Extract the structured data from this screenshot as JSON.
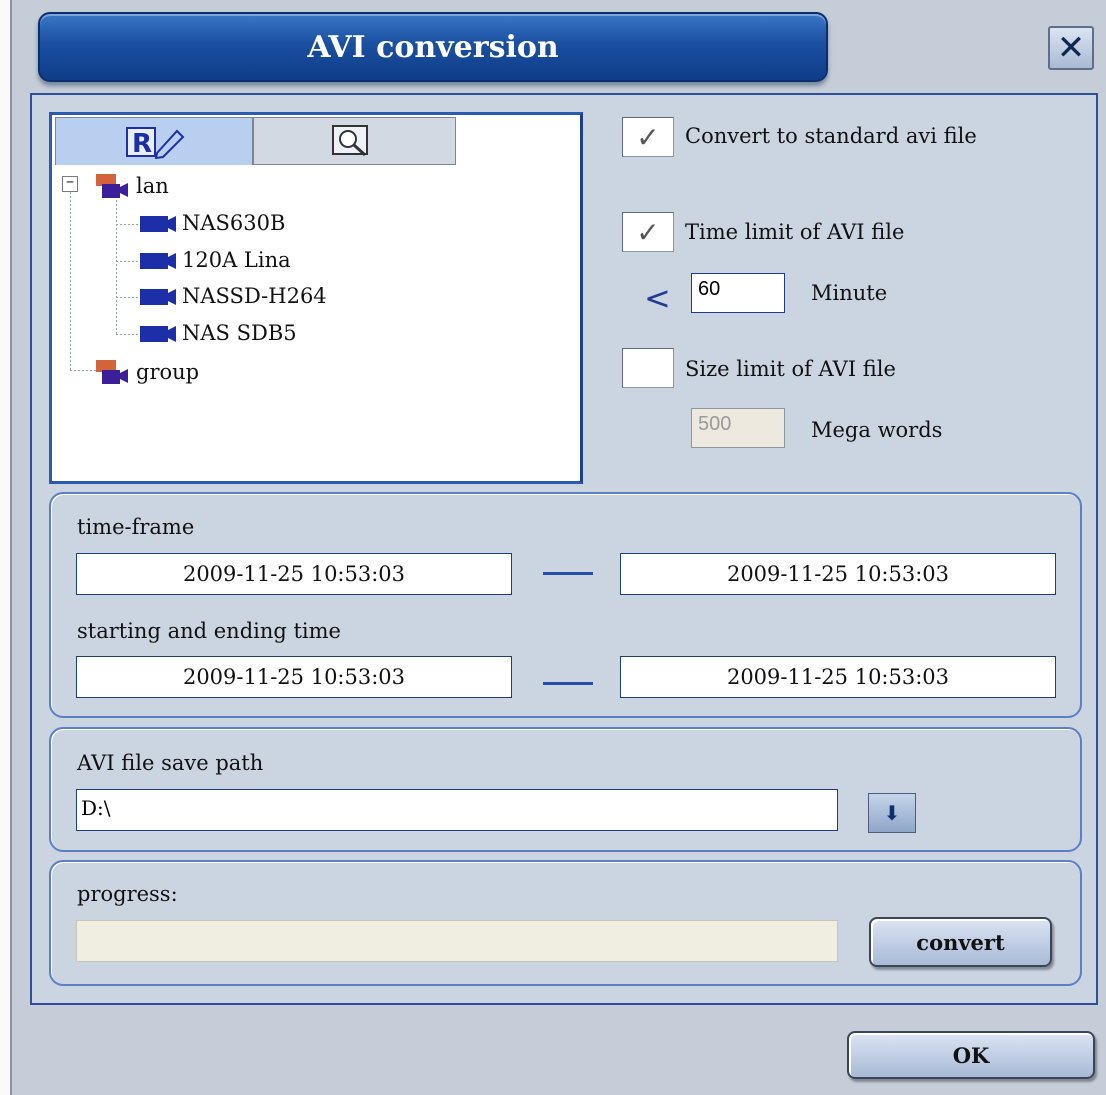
{
  "window": {
    "title": "AVI conversion",
    "close_label": "✕"
  },
  "tree": {
    "tabs": [
      {
        "icon": "record-edit-icon",
        "label": "R",
        "selected": true
      },
      {
        "icon": "search-icon",
        "selected": false
      }
    ],
    "nodes": {
      "lan": "lan",
      "devices": [
        "NAS630B",
        "120A Lina",
        "NASSD-H264",
        "NAS SDB5"
      ],
      "group": "group"
    },
    "expander_symbol": "−"
  },
  "options": {
    "convert_standard": {
      "label": "Convert to standard avi file",
      "checked": true
    },
    "time_limit": {
      "label": "Time limit of AVI file",
      "checked": true,
      "operator": "<",
      "value": "60",
      "unit": "Minute"
    },
    "size_limit": {
      "label": "Size limit of AVI file",
      "checked": false,
      "value": "500",
      "unit": "Mega words"
    },
    "check_glyph": "✓"
  },
  "time": {
    "time_frame_label": "time-frame",
    "time_frame_start": "2009-11-25 10:53:03",
    "time_frame_end": "2009-11-25 10:53:03",
    "start_end_label": "starting and ending time",
    "start_time": "2009-11-25 10:53:03",
    "end_time": "2009-11-25 10:53:03"
  },
  "save": {
    "label": "AVI file save path",
    "path": "D:\\",
    "browse_symbol": "⬇"
  },
  "progress": {
    "label": "progress:",
    "value": 0,
    "convert_label": "convert"
  },
  "footer": {
    "ok_label": "OK"
  },
  "colors": {
    "title_bar": "#1a4fa0",
    "accent": "#244ea8",
    "camera": "#1c2fa8",
    "folder_top": "#d2633a"
  }
}
